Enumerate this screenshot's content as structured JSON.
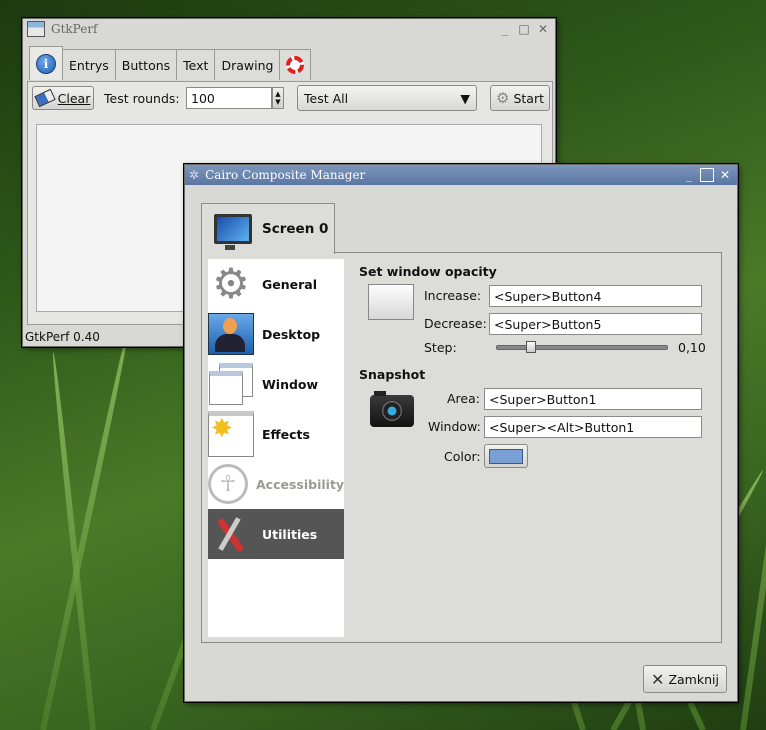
{
  "gtkperf": {
    "title": "GtkPerf",
    "tabs": [
      "Entrys",
      "Buttons",
      "Text",
      "Drawing"
    ],
    "clear_label": "Clear",
    "test_rounds_label": "Test rounds:",
    "test_rounds_value": "100",
    "test_select_value": "Test All",
    "start_label": "Start",
    "status": "GtkPerf 0.40"
  },
  "ccm": {
    "title": "Cairo Composite Manager",
    "screen_tab": "Screen 0",
    "sidebar": [
      {
        "label": "General",
        "icon": "gear-icon",
        "state": "normal"
      },
      {
        "label": "Desktop",
        "icon": "desktop-user-icon",
        "state": "normal"
      },
      {
        "label": "Window",
        "icon": "window-icon",
        "state": "normal"
      },
      {
        "label": "Effects",
        "icon": "effects-star-icon",
        "state": "normal"
      },
      {
        "label": "Accessibility",
        "icon": "accessibility-icon",
        "state": "disabled"
      },
      {
        "label": "Utilities",
        "icon": "tools-icon",
        "state": "selected"
      }
    ],
    "opacity": {
      "header": "Set window opacity",
      "increase_label": "Increase:",
      "increase_value": "<Super>Button4",
      "decrease_label": "Decrease:",
      "decrease_value": "<Super>Button5",
      "step_label": "Step:",
      "step_value": "0,10",
      "step_fraction": 0.2
    },
    "snapshot": {
      "header": "Snapshot",
      "area_label": "Area:",
      "area_value": "<Super>Button1",
      "window_label": "Window:",
      "window_value": "<Super><Alt>Button1",
      "color_label": "Color:",
      "color_value": "#7a9fd6"
    },
    "close_label": "Zamknij"
  }
}
